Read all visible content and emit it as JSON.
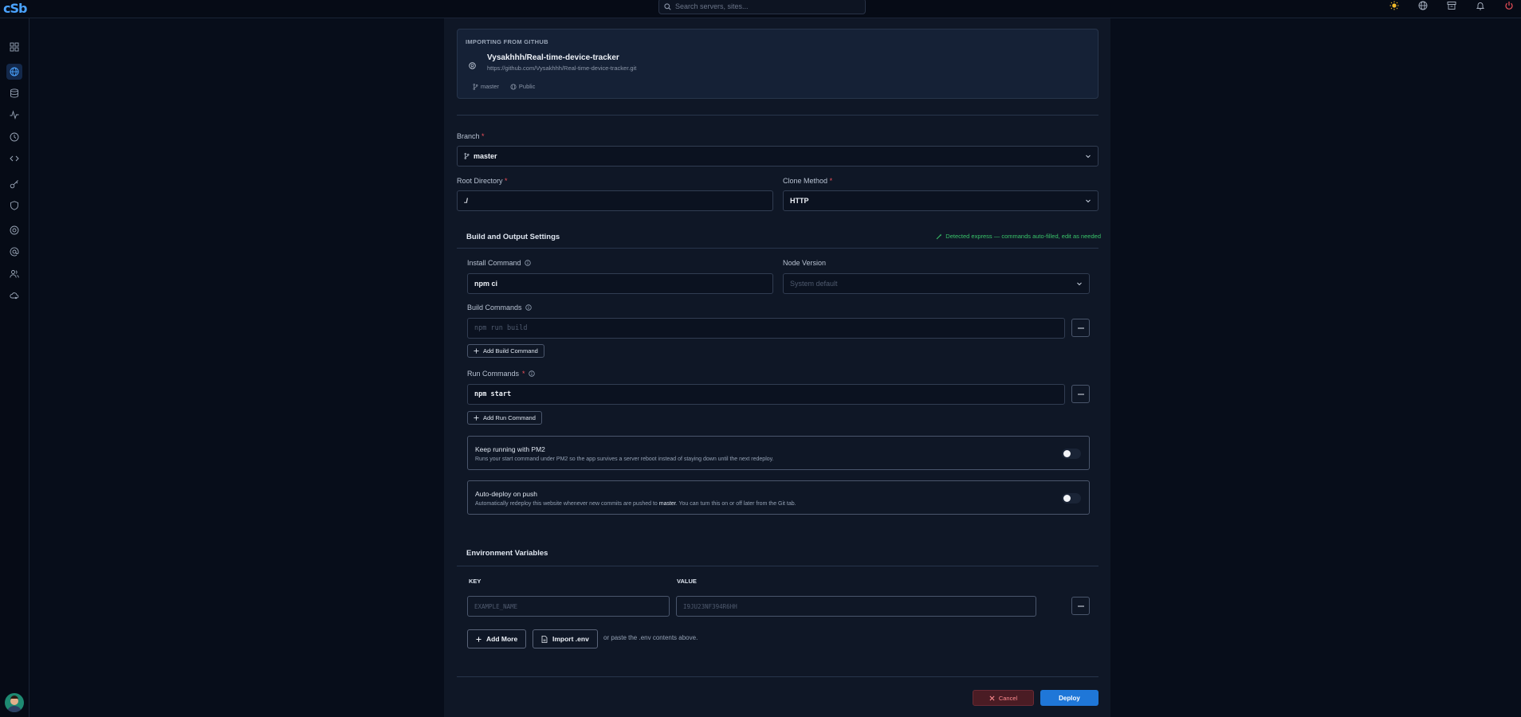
{
  "app": {
    "logo_text": "cSb"
  },
  "search": {
    "placeholder": "Search servers, sites..."
  },
  "top_icons": [
    "sun-icon",
    "globe-icon",
    "archive-icon",
    "bell-icon",
    "power-icon"
  ],
  "sidebar": {
    "items": [
      "dashboard-icon",
      "sites-icon",
      "database-icon",
      "activity-icon",
      "clock-icon",
      "code-icon",
      "key-icon",
      "shield-icon",
      "support-icon",
      "at-icon",
      "users-icon",
      "cloud-settings-icon"
    ],
    "active_index": 1
  },
  "import": {
    "heading": "IMPORTING FROM GITHUB",
    "repo_name": "Vysakhhh/Real-time-device-tracker",
    "repo_url": "https://github.com/Vysakhhh/Real-time-device-tracker.git",
    "branch": "master",
    "visibility": "Public"
  },
  "form": {
    "branch_label": "Branch",
    "branch_value": "master",
    "root_label": "Root Directory",
    "root_value": "./",
    "clone_label": "Clone Method",
    "clone_value": "HTTP"
  },
  "build": {
    "title": "Build and Output Settings",
    "detected": "Detected express — commands auto-filled, edit as needed",
    "install_label": "Install Command",
    "install_value": "npm ci",
    "node_label": "Node Version",
    "node_placeholder": "System default",
    "build_label": "Build Commands",
    "build_placeholder": "npm run build",
    "add_build": "Add Build Command",
    "run_label": "Run Commands",
    "run_value": "npm start",
    "add_run": "Add Run Command",
    "pm2_title": "Keep running with PM2",
    "pm2_desc": "Runs your start command under PM2 so the app survives a server reboot instead of staying down until the next redeploy.",
    "pm2_on": false,
    "auto_title": "Auto-deploy on push",
    "auto_desc_1": "Automatically redeploy this website whenever new commits are pushed to",
    "auto_desc_branch": "master",
    "auto_desc_2": ". You can turn this on or off later from the Git tab.",
    "auto_on": false
  },
  "env": {
    "title": "Environment Variables",
    "key_head": "KEY",
    "value_head": "VALUE",
    "key_placeholder": "EXAMPLE_NAME",
    "value_placeholder": "I9JU23NF394R6HH",
    "add_more": "Add More",
    "import_env": "Import .env",
    "hint": "or paste the .env contents above."
  },
  "footer": {
    "cancel": "Cancel",
    "deploy": "Deploy"
  },
  "colors": {
    "accent": "#1f77d8",
    "success": "#39c46a",
    "danger": "#f0505a"
  }
}
